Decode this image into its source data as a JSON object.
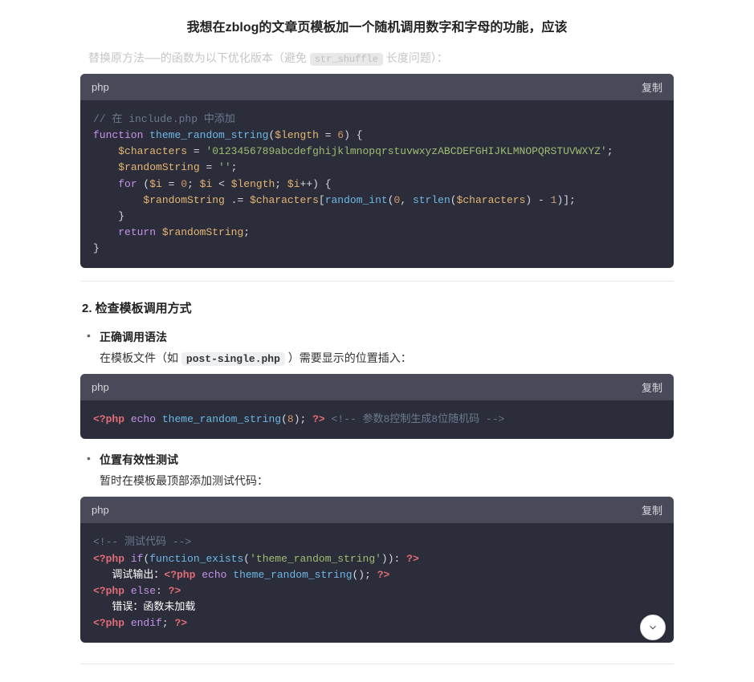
{
  "page_title": "我想在zblog的文章页模板加一个随机调用数字和字母的功能，应该",
  "faded": {
    "prefix": "替换原方法──的函数为以下优化版本（避免 ",
    "code": "str_shuffle",
    "suffix": " 长度问题）："
  },
  "block1": {
    "lang": "php",
    "copy": "复制",
    "l1_comment": "// 在 include.php 中添加",
    "l2_kw": "function",
    "l2_name": "theme_random_string",
    "l2_paren1": "(",
    "l2_var": "$length",
    "l2_eq": " = ",
    "l2_num": "6",
    "l2_paren2": ") {",
    "l3_var": "$characters",
    "l3_eq": " = ",
    "l3_str": "'0123456789abcdefghijklmnopqrstuvwxyzABCDEFGHIJKLMNOPQRSTUVWXYZ'",
    "l3_semi": ";",
    "l4_var": "$randomString",
    "l4_eq": " = ",
    "l4_str": "''",
    "l4_semi": ";",
    "l5_for": "for",
    "l5_rest1": " (",
    "l5_var1": "$i",
    "l5_eq1": " = ",
    "l5_n0": "0",
    "l5_semi1": "; ",
    "l5_var2": "$i",
    "l5_lt": " < ",
    "l5_var3": "$length",
    "l5_semi2": "; ",
    "l5_var4": "$i",
    "l5_pp": "++) {",
    "l6_var1": "$randomString",
    "l6_cat": " .= ",
    "l6_var2": "$characters",
    "l6_br1": "[",
    "l6_fn1": "random_int",
    "l6_p1": "(",
    "l6_n0": "0",
    "l6_comma": ", ",
    "l6_fn2": "strlen",
    "l6_p2": "(",
    "l6_var3": "$characters",
    "l6_p3": ") - ",
    "l6_n1": "1",
    "l6_p4": ")];",
    "l7_brace": "}",
    "l8_ret": "return",
    "l8_sp": " ",
    "l8_var": "$randomString",
    "l8_semi": ";",
    "l9_brace": "}"
  },
  "section2": "2. 检查模板调用方式",
  "b1_title": "正确调用语法",
  "b1_text_pre": "在模板文件（如 ",
  "b1_text_code": "post-single.php",
  "b1_text_suf": " ）需要显示的位置插入：",
  "block2": {
    "lang": "php",
    "copy": "复制",
    "tag1": "<?php",
    "sp1": " ",
    "echo": "echo",
    "sp2": " ",
    "fn": "theme_random_string",
    "p1": "(",
    "n8": "8",
    "p2": "); ",
    "tag2": "?>",
    "sp3": " ",
    "comment": "<!-- 参数8控制生成8位随机码 -->"
  },
  "b2_title": "位置有效性测试",
  "b2_text": "暂时在模板最顶部添加测试代码：",
  "block3": {
    "lang": "php",
    "copy": "复制",
    "l1_comment": "<!-- 测试代码 -->",
    "l2_tag1": "<?php",
    "l2_sp": " ",
    "l2_if": "if",
    "l2_p1": "(",
    "l2_fn": "function_exists",
    "l2_p2": "(",
    "l2_str": "'theme_random_string'",
    "l2_p3": ")): ",
    "l2_tag2": "?>",
    "l3_txt": "   调试输出：",
    "l3_tag1": "<?php",
    "l3_sp": " ",
    "l3_echo": "echo",
    "l3_sp2": " ",
    "l3_fn": "theme_random_string",
    "l3_p": "(); ",
    "l3_tag2": "?>",
    "l4_tag1": "<?php",
    "l4_sp": " ",
    "l4_else": "else",
    "l4_colon": ": ",
    "l4_tag2": "?>",
    "l5_txt": "   错误：函数未加载",
    "l6_tag1": "<?php",
    "l6_sp": " ",
    "l6_endif": "endif",
    "l6_semi": "; ",
    "l6_tag2": "?>"
  }
}
